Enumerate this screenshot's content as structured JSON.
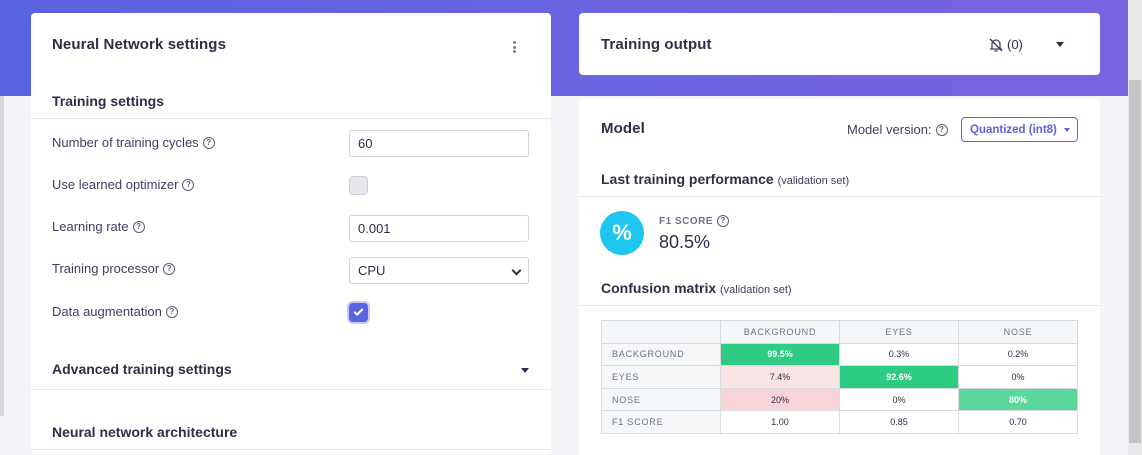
{
  "nn_settings": {
    "title": "Neural Network settings",
    "training_settings_heading": "Training settings",
    "rows": {
      "cycles_label": "Number of training cycles",
      "cycles_value": "60",
      "optimizer_label": "Use learned optimizer",
      "optimizer_checked": false,
      "learning_rate_label": "Learning rate",
      "learning_rate_value": "0.001",
      "processor_label": "Training processor",
      "processor_value": "CPU",
      "augmentation_label": "Data augmentation",
      "augmentation_checked": true
    },
    "advanced_heading": "Advanced training settings",
    "architecture_heading": "Neural network architecture"
  },
  "training_output": {
    "title": "Training output",
    "notification_count": "(0)"
  },
  "model": {
    "title": "Model",
    "version_label": "Model version:",
    "version_value": "Quantized (int8)",
    "last_perf_heading": "Last training performance",
    "last_perf_note": "(validation set)",
    "f1_symbol": "%",
    "f1_label": "F1 SCORE",
    "f1_value": "80.5%",
    "confusion_heading": "Confusion matrix",
    "confusion_note": "(validation set)",
    "matrix": {
      "columns": [
        "BACKGROUND",
        "EYES",
        "NOSE"
      ],
      "rows": [
        {
          "label": "BACKGROUND",
          "cells": [
            "99.5%",
            "0.3%",
            "0.2%"
          ]
        },
        {
          "label": "EYES",
          "cells": [
            "7.4%",
            "92.6%",
            "0%"
          ]
        },
        {
          "label": "NOSE",
          "cells": [
            "20%",
            "0%",
            "80%"
          ]
        },
        {
          "label": "F1 SCORE",
          "cells": [
            "1.00",
            "0.85",
            "0.70"
          ]
        }
      ]
    }
  },
  "colors": {
    "accent": "#5a63e0",
    "f1_badge": "#1fc6f0",
    "matrix_correct": "#2ecc82",
    "matrix_error": "#f9d3d8"
  },
  "icons": [
    "help-icon",
    "kebab-menu-icon",
    "bell-off-icon",
    "chevron-down-icon",
    "checkmark-icon"
  ]
}
